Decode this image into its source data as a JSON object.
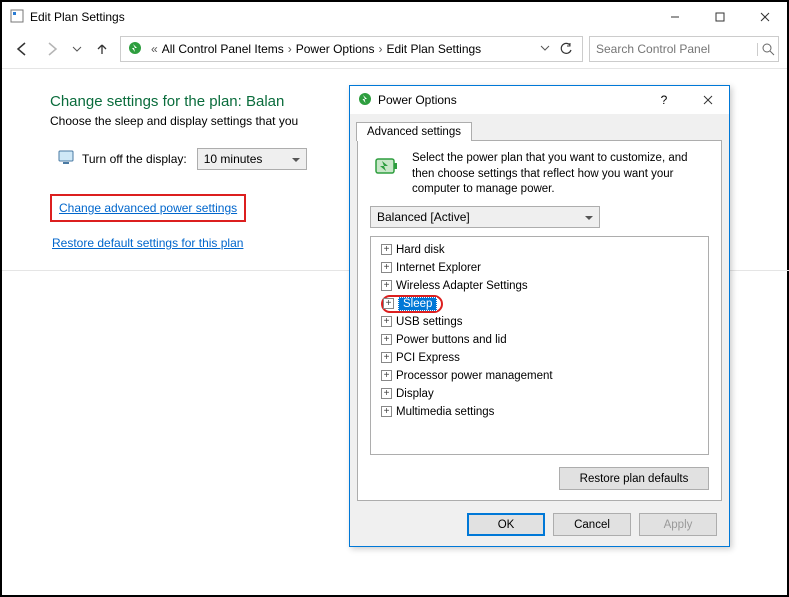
{
  "window": {
    "title": "Edit Plan Settings"
  },
  "breadcrumb": {
    "items": [
      "All Control Panel Items",
      "Power Options",
      "Edit Plan Settings"
    ]
  },
  "search": {
    "placeholder": "Search Control Panel"
  },
  "page": {
    "heading_prefix": "Change settings for the plan: ",
    "heading_plan": "Balan",
    "sub": "Choose the sleep and display settings that you",
    "turn_off_label": "Turn off the display:",
    "turn_off_value": "10 minutes",
    "link_advanced": "Change advanced power settings",
    "link_restore": "Restore default settings for this plan"
  },
  "dialog": {
    "title": "Power Options",
    "tab": "Advanced settings",
    "intro": "Select the power plan that you want to customize, and then choose settings that reflect how you want your computer to manage power.",
    "plan_selected": "Balanced [Active]",
    "tree": [
      "Hard disk",
      "Internet Explorer",
      "Wireless Adapter Settings",
      "Sleep",
      "USB settings",
      "Power buttons and lid",
      "PCI Express",
      "Processor power management",
      "Display",
      "Multimedia settings"
    ],
    "restore_btn": "Restore plan defaults",
    "ok": "OK",
    "cancel": "Cancel",
    "apply": "Apply"
  }
}
